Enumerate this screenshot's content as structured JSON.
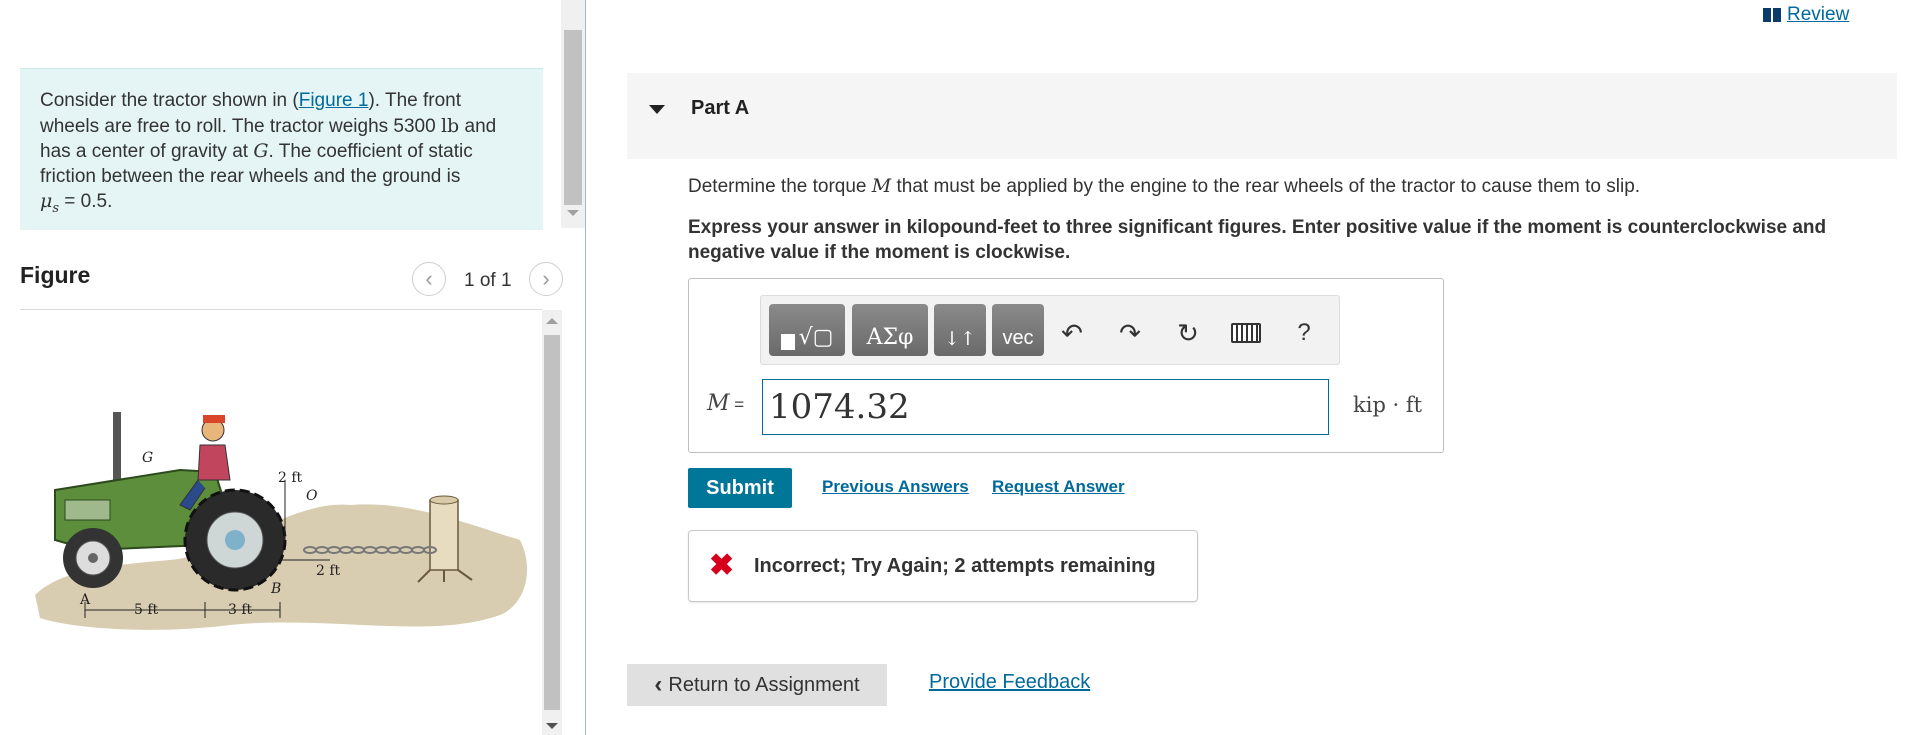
{
  "problem": {
    "intro": "Consider the tractor shown in (",
    "figure_link": "Figure 1",
    "body1": "). The front wheels are free to roll. The tractor weighs 5300 ",
    "weight_unit": "lb",
    "body2": " and has a center of gravity at ",
    "g_symbol": "G",
    "body3": ". The coefficient of static friction between the rear wheels and the ground is",
    "mu_symbol": "μ",
    "mu_sub": "s",
    "mu_value": " = 0.5."
  },
  "figure": {
    "title": "Figure",
    "counter": "1 of 1",
    "labels": {
      "g": "G",
      "o": "O",
      "a": "A",
      "b": "B",
      "dim_top": "2 ft",
      "dim_mid": "2 ft",
      "dim_left": "5 ft",
      "dim_right": "3 ft"
    }
  },
  "review": {
    "label": "Review"
  },
  "part": {
    "title": "Part A",
    "question_pre": "Determine the torque ",
    "question_var": "M",
    "question_post": " that must be applied by the engine to the rear wheels of the tractor to cause them to slip.",
    "instructions": "Express your answer in kilopound-feet to three significant figures. Enter positive value if the moment is counterclockwise and negative value if the moment is clockwise."
  },
  "toolbar": {
    "templates_label": "√▢",
    "greek_label": "ΑΣφ",
    "arrows_label": "↓↑",
    "vec_label": "vec"
  },
  "answer": {
    "var_label": "M =",
    "value": "1074.32",
    "unit": "kip · ft"
  },
  "actions": {
    "submit": "Submit",
    "previous_answers": "Previous Answers",
    "request_answer": "Request Answer"
  },
  "feedback": {
    "icon": "✖",
    "message": "Incorrect; Try Again; 2 attempts remaining"
  },
  "footer": {
    "return": "Return to Assignment",
    "provide_feedback": "Provide Feedback"
  }
}
